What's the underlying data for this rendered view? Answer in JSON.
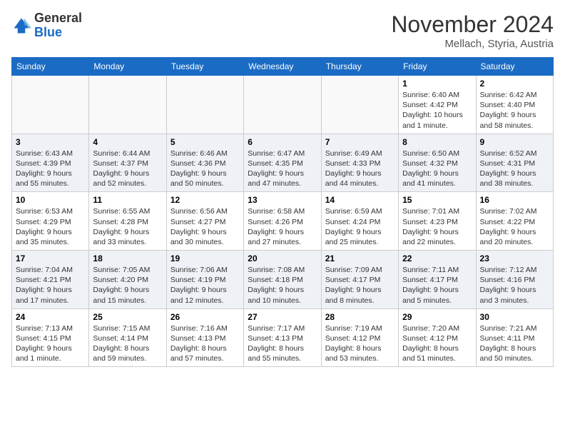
{
  "header": {
    "logo_general": "General",
    "logo_blue": "Blue",
    "month_title": "November 2024",
    "location": "Mellach, Styria, Austria"
  },
  "weekdays": [
    "Sunday",
    "Monday",
    "Tuesday",
    "Wednesday",
    "Thursday",
    "Friday",
    "Saturday"
  ],
  "weeks": [
    [
      {
        "day": "",
        "info": ""
      },
      {
        "day": "",
        "info": ""
      },
      {
        "day": "",
        "info": ""
      },
      {
        "day": "",
        "info": ""
      },
      {
        "day": "",
        "info": ""
      },
      {
        "day": "1",
        "info": "Sunrise: 6:40 AM\nSunset: 4:42 PM\nDaylight: 10 hours and 1 minute."
      },
      {
        "day": "2",
        "info": "Sunrise: 6:42 AM\nSunset: 4:40 PM\nDaylight: 9 hours and 58 minutes."
      }
    ],
    [
      {
        "day": "3",
        "info": "Sunrise: 6:43 AM\nSunset: 4:39 PM\nDaylight: 9 hours and 55 minutes."
      },
      {
        "day": "4",
        "info": "Sunrise: 6:44 AM\nSunset: 4:37 PM\nDaylight: 9 hours and 52 minutes."
      },
      {
        "day": "5",
        "info": "Sunrise: 6:46 AM\nSunset: 4:36 PM\nDaylight: 9 hours and 50 minutes."
      },
      {
        "day": "6",
        "info": "Sunrise: 6:47 AM\nSunset: 4:35 PM\nDaylight: 9 hours and 47 minutes."
      },
      {
        "day": "7",
        "info": "Sunrise: 6:49 AM\nSunset: 4:33 PM\nDaylight: 9 hours and 44 minutes."
      },
      {
        "day": "8",
        "info": "Sunrise: 6:50 AM\nSunset: 4:32 PM\nDaylight: 9 hours and 41 minutes."
      },
      {
        "day": "9",
        "info": "Sunrise: 6:52 AM\nSunset: 4:31 PM\nDaylight: 9 hours and 38 minutes."
      }
    ],
    [
      {
        "day": "10",
        "info": "Sunrise: 6:53 AM\nSunset: 4:29 PM\nDaylight: 9 hours and 35 minutes."
      },
      {
        "day": "11",
        "info": "Sunrise: 6:55 AM\nSunset: 4:28 PM\nDaylight: 9 hours and 33 minutes."
      },
      {
        "day": "12",
        "info": "Sunrise: 6:56 AM\nSunset: 4:27 PM\nDaylight: 9 hours and 30 minutes."
      },
      {
        "day": "13",
        "info": "Sunrise: 6:58 AM\nSunset: 4:26 PM\nDaylight: 9 hours and 27 minutes."
      },
      {
        "day": "14",
        "info": "Sunrise: 6:59 AM\nSunset: 4:24 PM\nDaylight: 9 hours and 25 minutes."
      },
      {
        "day": "15",
        "info": "Sunrise: 7:01 AM\nSunset: 4:23 PM\nDaylight: 9 hours and 22 minutes."
      },
      {
        "day": "16",
        "info": "Sunrise: 7:02 AM\nSunset: 4:22 PM\nDaylight: 9 hours and 20 minutes."
      }
    ],
    [
      {
        "day": "17",
        "info": "Sunrise: 7:04 AM\nSunset: 4:21 PM\nDaylight: 9 hours and 17 minutes."
      },
      {
        "day": "18",
        "info": "Sunrise: 7:05 AM\nSunset: 4:20 PM\nDaylight: 9 hours and 15 minutes."
      },
      {
        "day": "19",
        "info": "Sunrise: 7:06 AM\nSunset: 4:19 PM\nDaylight: 9 hours and 12 minutes."
      },
      {
        "day": "20",
        "info": "Sunrise: 7:08 AM\nSunset: 4:18 PM\nDaylight: 9 hours and 10 minutes."
      },
      {
        "day": "21",
        "info": "Sunrise: 7:09 AM\nSunset: 4:17 PM\nDaylight: 9 hours and 8 minutes."
      },
      {
        "day": "22",
        "info": "Sunrise: 7:11 AM\nSunset: 4:17 PM\nDaylight: 9 hours and 5 minutes."
      },
      {
        "day": "23",
        "info": "Sunrise: 7:12 AM\nSunset: 4:16 PM\nDaylight: 9 hours and 3 minutes."
      }
    ],
    [
      {
        "day": "24",
        "info": "Sunrise: 7:13 AM\nSunset: 4:15 PM\nDaylight: 9 hours and 1 minute."
      },
      {
        "day": "25",
        "info": "Sunrise: 7:15 AM\nSunset: 4:14 PM\nDaylight: 8 hours and 59 minutes."
      },
      {
        "day": "26",
        "info": "Sunrise: 7:16 AM\nSunset: 4:13 PM\nDaylight: 8 hours and 57 minutes."
      },
      {
        "day": "27",
        "info": "Sunrise: 7:17 AM\nSunset: 4:13 PM\nDaylight: 8 hours and 55 minutes."
      },
      {
        "day": "28",
        "info": "Sunrise: 7:19 AM\nSunset: 4:12 PM\nDaylight: 8 hours and 53 minutes."
      },
      {
        "day": "29",
        "info": "Sunrise: 7:20 AM\nSunset: 4:12 PM\nDaylight: 8 hours and 51 minutes."
      },
      {
        "day": "30",
        "info": "Sunrise: 7:21 AM\nSunset: 4:11 PM\nDaylight: 8 hours and 50 minutes."
      }
    ]
  ]
}
